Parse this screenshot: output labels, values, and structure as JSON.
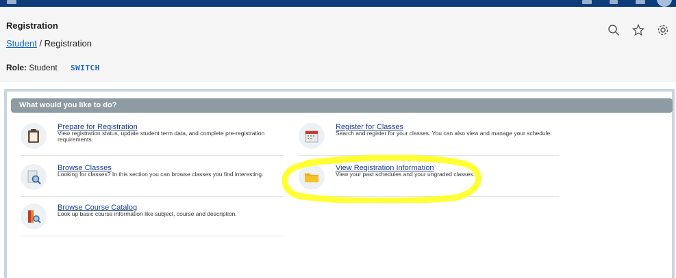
{
  "header": {
    "title": "Registration",
    "breadcrumb": {
      "link": "Student",
      "separator": " / ",
      "current": "Registration"
    },
    "role_label": "Role:",
    "role_value": "Student",
    "switch_label": "SWITCH",
    "icons": [
      "search-icon",
      "star-icon",
      "gear-icon"
    ]
  },
  "panel": {
    "heading": "What would you like to do?",
    "items": [
      {
        "title": "Prepare for Registration",
        "desc": "View registration status, update student term data, and complete pre-registration requirements.",
        "icon": "clipboard-icon"
      },
      {
        "title": "Register for Classes",
        "desc": "Search and register for your classes. You can also view and manage your schedule.",
        "icon": "calendar-icon"
      },
      {
        "title": "Browse Classes",
        "desc": "Looking for classes? In this section you can browse classes you find interesting.",
        "icon": "magnifier-page-icon"
      },
      {
        "title": "View Registration Information",
        "desc": "View your past schedules and your ungraded classes.",
        "icon": "folder-icon"
      },
      {
        "title": "Browse Course Catalog",
        "desc": "Look up basic course information like subject, course and description.",
        "icon": "book-catalog-icon"
      }
    ]
  },
  "colors": {
    "accent": "#1a66c9",
    "topbar": "#0d3c7a",
    "highlight": "#ffff33"
  }
}
